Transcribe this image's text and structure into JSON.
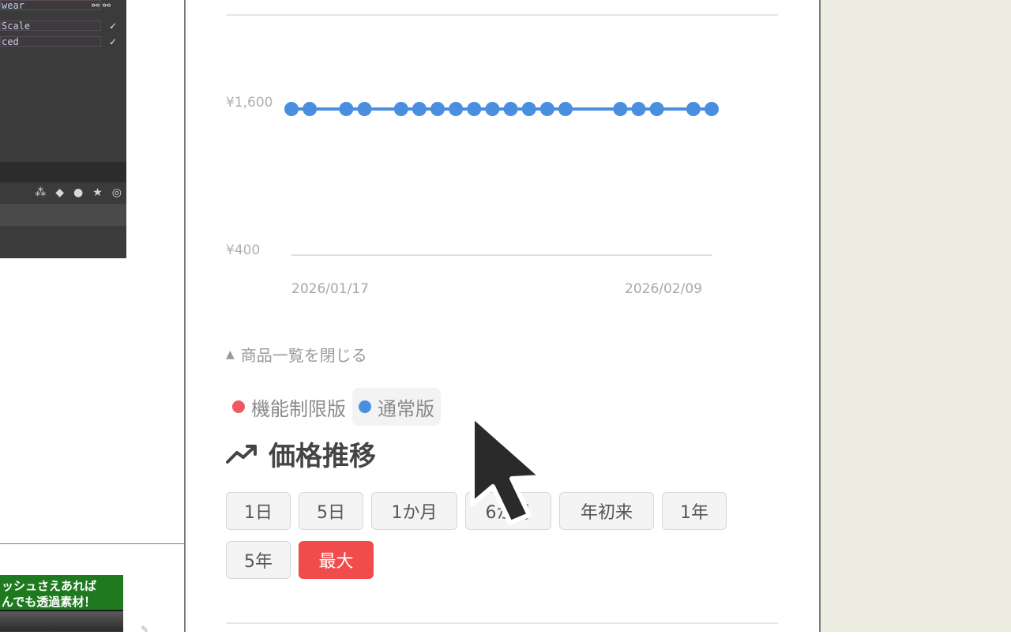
{
  "left_thumbnail": {
    "rows": [
      {
        "label": "wear",
        "checks": "⚯ ⚯"
      },
      {
        "label": "Scale",
        "checks": "✓"
      },
      {
        "label": "ced",
        "checks": "✓"
      }
    ],
    "banner_lines": [
      "ッシュさえあれば",
      "んでも透過素材！"
    ]
  },
  "chart": {
    "y_labels": [
      "¥1,600",
      "¥400"
    ],
    "x_labels": [
      "2026/01/17",
      "2026/02/09"
    ],
    "series_color": "#4a8ee0",
    "baseline_color": "#e0e0e0"
  },
  "chart_data": {
    "type": "line",
    "title": "",
    "ylabel": "",
    "xlabel": "",
    "ylim": [
      400,
      1600
    ],
    "x_range": [
      "2026/01/17",
      "2026/02/09"
    ],
    "series": [
      {
        "name": "通常版",
        "color": "#4a8ee0",
        "x": [
          "2026/01/17",
          "2026/01/18",
          "2026/01/20",
          "2026/01/21",
          "2026/01/23",
          "2026/01/24",
          "2026/01/25",
          "2026/01/26",
          "2026/01/27",
          "2026/01/28",
          "2026/01/29",
          "2026/01/30",
          "2026/01/31",
          "2026/02/01",
          "2026/02/04",
          "2026/02/05",
          "2026/02/06",
          "2026/02/08",
          "2026/02/09"
        ],
        "values": [
          1600,
          1600,
          1600,
          1600,
          1600,
          1600,
          1600,
          1600,
          1600,
          1600,
          1600,
          1600,
          1600,
          1600,
          1600,
          1600,
          1600,
          1600,
          1600
        ]
      }
    ]
  },
  "toggle": {
    "icon": "▲",
    "label": "商品一覧を閉じる"
  },
  "legend": [
    {
      "label": "機能制限版",
      "color": "#ef5a62",
      "active": false
    },
    {
      "label": "通常版",
      "color": "#4a8ee0",
      "active": true
    }
  ],
  "section": {
    "title": "価格推移",
    "icon": "trending-up"
  },
  "range_buttons": [
    {
      "label": "1日",
      "active": false
    },
    {
      "label": "5日",
      "active": false
    },
    {
      "label": "1か月",
      "active": false
    },
    {
      "label": "6か月",
      "active": false
    },
    {
      "label": "年初来",
      "active": false
    },
    {
      "label": "1年",
      "active": false
    },
    {
      "label": "5年",
      "active": false
    },
    {
      "label": "最大",
      "active": true
    }
  ],
  "colors": {
    "accent_red": "#f24b4b",
    "right_panel": "#ecece0"
  }
}
